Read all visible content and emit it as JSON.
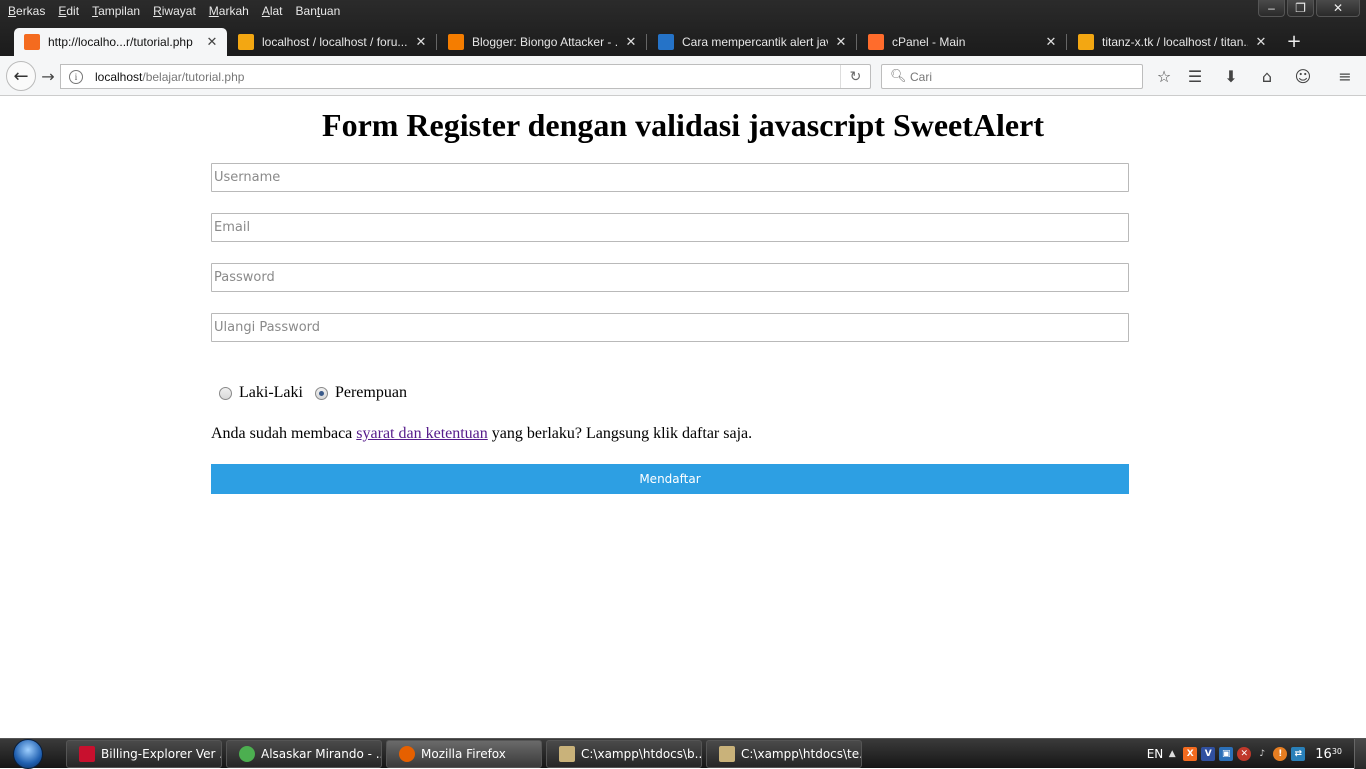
{
  "window": {
    "controls": {
      "minimize": "–",
      "restore": "❐",
      "close": "✕"
    }
  },
  "menubar": {
    "items": [
      {
        "accel": "B",
        "rest": "erkas"
      },
      {
        "accel": "E",
        "rest": "dit"
      },
      {
        "accel": "T",
        "rest": "ampilan"
      },
      {
        "accel": "R",
        "rest": "iwayat"
      },
      {
        "accel": "M",
        "rest": "arkah"
      },
      {
        "accel": "A",
        "rest": "lat"
      },
      {
        "pre": "Ban",
        "accel": "t",
        "rest": "uan"
      }
    ]
  },
  "tabs": [
    {
      "title": "http://localho...r/tutorial.php",
      "icon": "xampp-icon",
      "color": "#f46b1f"
    },
    {
      "title": "localhost / localhost / foru...",
      "icon": "phpmyadmin-icon",
      "color": "#f3a712"
    },
    {
      "title": "Blogger: Biongo Attacker - ...",
      "icon": "blogger-icon",
      "color": "#f57d00"
    },
    {
      "title": "Cara mempercantik alert jav...",
      "icon": "azure-icon",
      "color": "#2573c8"
    },
    {
      "title": "cPanel - Main",
      "icon": "cpanel-icon",
      "color": "#ff6c2c"
    },
    {
      "title": "titanz-x.tk / localhost / titan...",
      "icon": "phpmyadmin-icon",
      "color": "#f3a712"
    }
  ],
  "navbar": {
    "url_host": "localhost",
    "url_path": "/belajar/tutorial.php",
    "search_placeholder": "Cari"
  },
  "page": {
    "title": "Form Register dengan validasi javascript SweetAlert",
    "fields": {
      "username_placeholder": "Username",
      "email_placeholder": "Email",
      "password_placeholder": "Password",
      "repeat_password_placeholder": "Ulangi Password"
    },
    "gender": {
      "male_label": "Laki-Laki",
      "female_label": "Perempuan",
      "selected": "Perempuan"
    },
    "terms": {
      "before": "Anda sudah membaca ",
      "link": "syarat dan ketentuan",
      "after": " yang berlaku? Langsung klik daftar saja."
    },
    "submit_label": "Mendaftar",
    "accent_color": "#2d9fe3"
  },
  "taskbar": {
    "tasks": [
      {
        "label": "Billing-Explorer Ver ...",
        "icon": "billing-icon",
        "color": "#c8102e"
      },
      {
        "label": "Alsaskar Mirando - ...",
        "icon": "chrome-icon",
        "color": "#4caf50"
      },
      {
        "label": "Mozilla Firefox",
        "icon": "firefox-icon",
        "color": "#e66000"
      },
      {
        "label": "C:\\xampp\\htdocs\\b...",
        "icon": "editor-icon",
        "color": "#c9b27a"
      },
      {
        "label": "C:\\xampp\\htdocs\\te...",
        "icon": "editor-icon",
        "color": "#c9b27a"
      }
    ],
    "tray": {
      "language": "EN",
      "clock_time": "16",
      "clock_min": "30",
      "clock_ampm": "PM"
    }
  }
}
